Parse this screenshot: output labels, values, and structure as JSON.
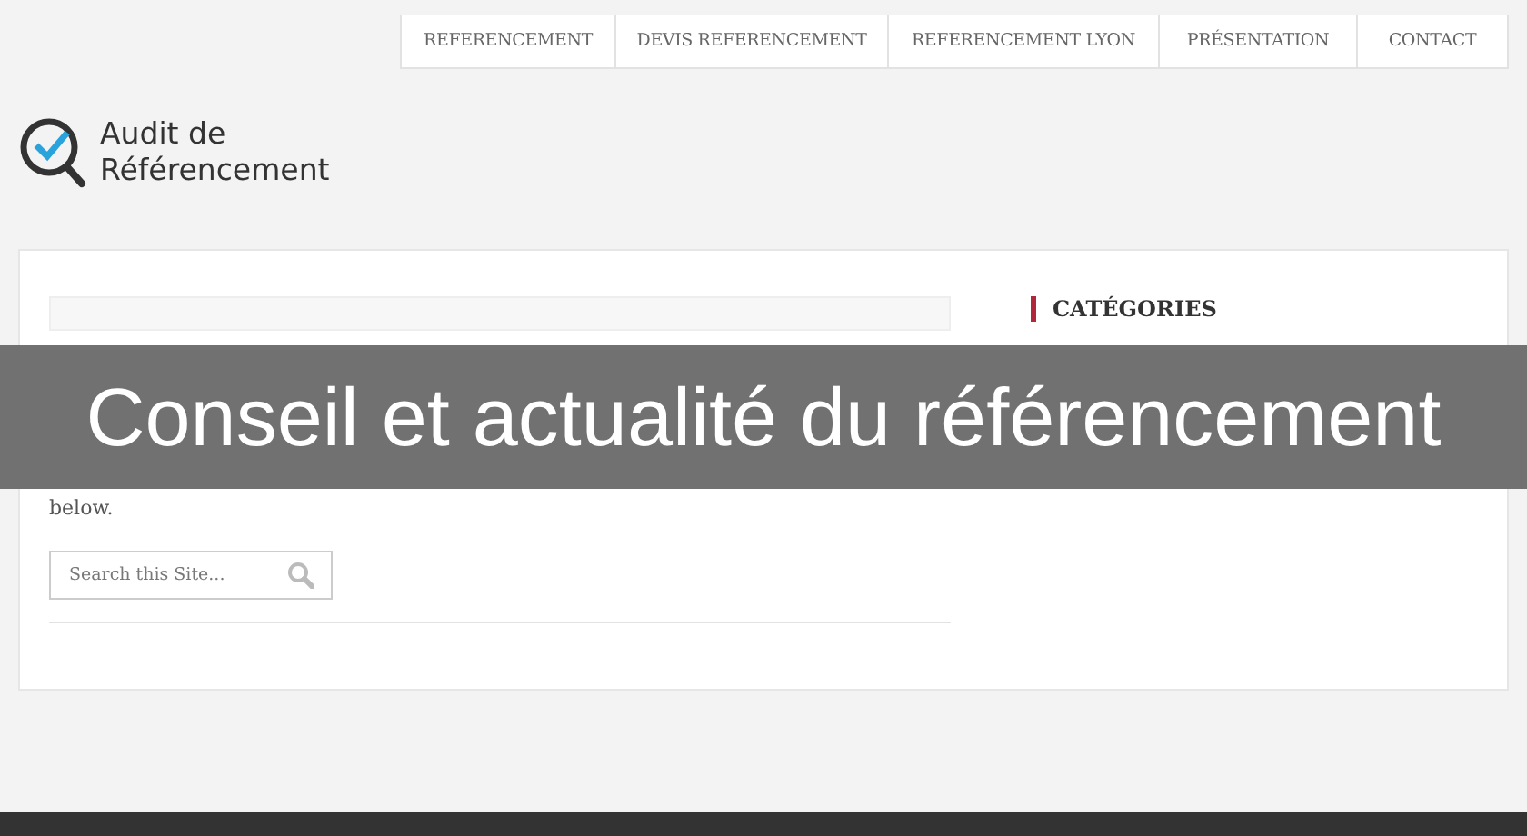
{
  "nav": {
    "items": [
      {
        "label": "REFERENCEMENT"
      },
      {
        "label": "DEVIS REFERENCEMENT"
      },
      {
        "label": "REFERENCEMENT LYON"
      },
      {
        "label": "PRÉSENTATION"
      },
      {
        "label": "CONTACT"
      }
    ]
  },
  "logo": {
    "line_1": "Audit de",
    "line_2": "Référencement"
  },
  "main": {
    "error_text": "below.",
    "search": {
      "placeholder": "Search this Site..."
    }
  },
  "sidebar": {
    "heading": "CATÉGORIES"
  },
  "banner": {
    "title": "Conseil et actualité du référencement"
  }
}
